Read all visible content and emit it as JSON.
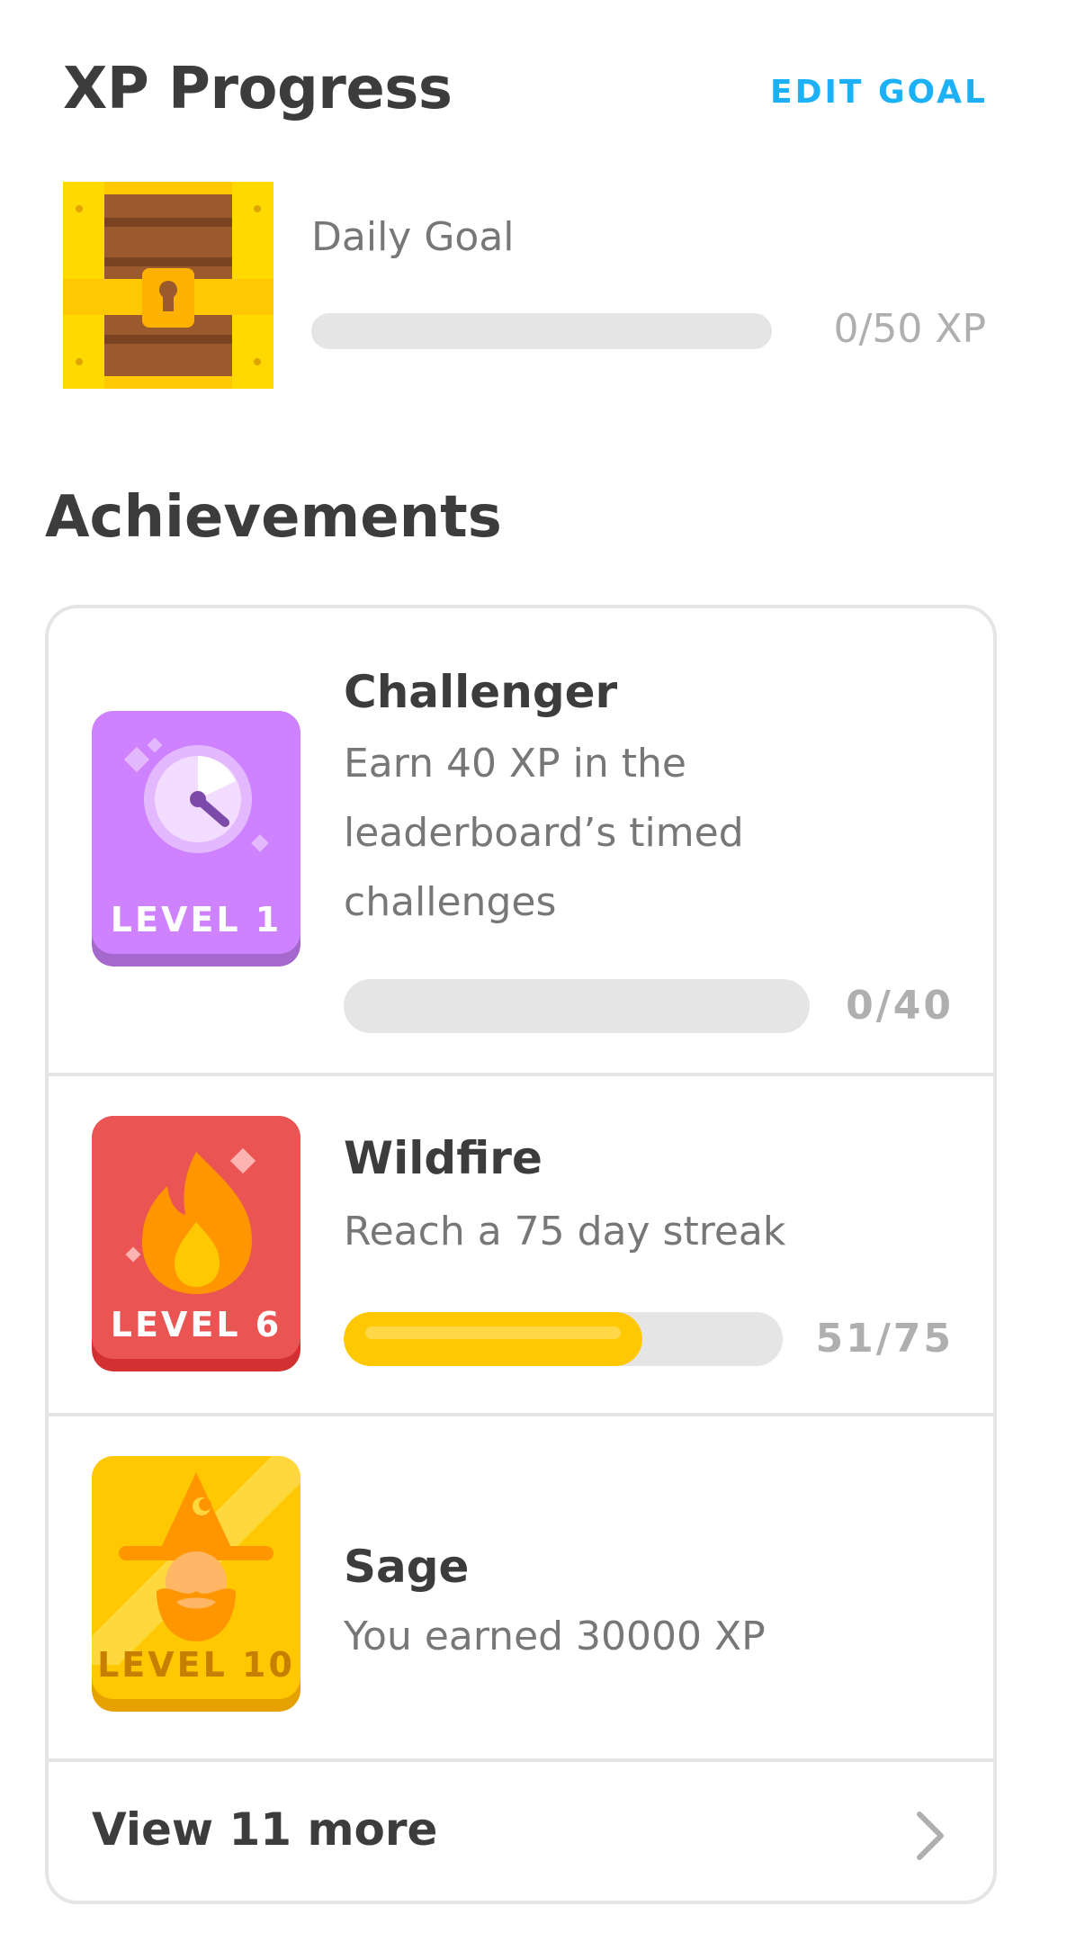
{
  "header": {
    "title": "XP Progress",
    "edit_goal": "EDIT GOAL"
  },
  "daily_goal": {
    "label": "Daily Goal",
    "value_text": "0/50 XP",
    "progress": 0,
    "icon": "treasure-chest-icon"
  },
  "achievements": {
    "title": "Achievements",
    "items": [
      {
        "name": "Challenger",
        "description": "Earn 40 XP in the leaderboard’s timed challenges",
        "level": "LEVEL 1",
        "count": "0/40",
        "progress": 0,
        "badge_color": "#ce82ff",
        "icon": "stopwatch-icon"
      },
      {
        "name": "Wildfire",
        "description": "Reach a 75 day streak",
        "level": "LEVEL 6",
        "count": "51/75",
        "progress": 0.68,
        "badge_color": "#ff4b4b",
        "icon": "flame-icon"
      },
      {
        "name": "Sage",
        "description": "You earned 30000 XP",
        "level": "LEVEL 10",
        "badge_color": "#ffc800",
        "icon": "wizard-icon"
      }
    ],
    "view_more": "View 11 more"
  },
  "colors": {
    "accent": "#1cb0f6",
    "progress_fill": "#ffc800",
    "track": "#e5e5e5"
  }
}
